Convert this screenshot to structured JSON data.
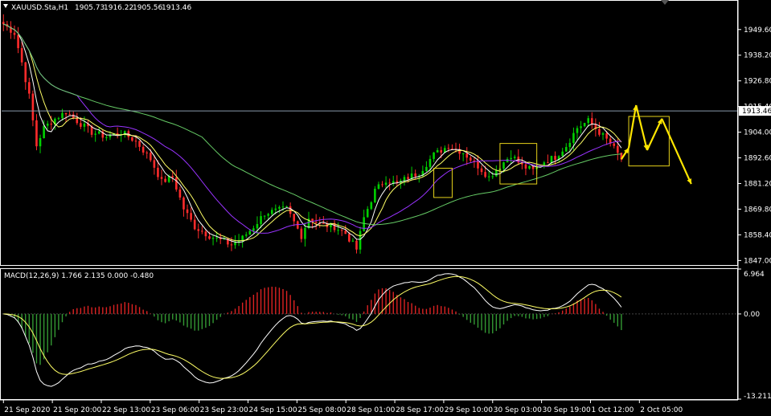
{
  "chart_data": [
    {
      "type": "candlestick",
      "title": "XAUUSD.Sta,H1",
      "ohlc": {
        "open": "1905.73",
        "high": "1916.22",
        "low": "1905.56",
        "close": "1913.46"
      },
      "price_label": "1913.46",
      "ylim": [
        1845.0,
        1962.0
      ],
      "yticks": [
        "1949.60",
        "1938.20",
        "1926.80",
        "1915.40",
        "1904.00",
        "1892.60",
        "1881.20",
        "1869.80",
        "1858.40",
        "1847.00"
      ],
      "xticks": [
        "21 Sep 2020",
        "21 Sep 20:00",
        "22 Sep 13:00",
        "23 Sep 06:00",
        "23 Sep 23:00",
        "24 Sep 15:00",
        "25 Sep 08:00",
        "28 Sep 01:00",
        "28 Sep 17:00",
        "29 Sep 10:00",
        "30 Sep 03:00",
        "30 Sep 19:00",
        "1 Oct 12:00",
        "2 Oct 05:00"
      ],
      "close_path": [
        {
          "t": 0,
          "v": 1952
        },
        {
          "t": 3,
          "v": 1948
        },
        {
          "t": 5,
          "v": 1935
        },
        {
          "t": 7,
          "v": 1920
        },
        {
          "t": 9,
          "v": 1898
        },
        {
          "t": 11,
          "v": 1906
        },
        {
          "t": 14,
          "v": 1910
        },
        {
          "t": 17,
          "v": 1913
        },
        {
          "t": 20,
          "v": 1909
        },
        {
          "t": 24,
          "v": 1904
        },
        {
          "t": 28,
          "v": 1902
        },
        {
          "t": 32,
          "v": 1904
        },
        {
          "t": 36,
          "v": 1900
        },
        {
          "t": 40,
          "v": 1892
        },
        {
          "t": 43,
          "v": 1882
        },
        {
          "t": 46,
          "v": 1884
        },
        {
          "t": 49,
          "v": 1870
        },
        {
          "t": 52,
          "v": 1862
        },
        {
          "t": 56,
          "v": 1858
        },
        {
          "t": 59,
          "v": 1856
        },
        {
          "t": 62,
          "v": 1854
        },
        {
          "t": 65,
          "v": 1857
        },
        {
          "t": 68,
          "v": 1862
        },
        {
          "t": 71,
          "v": 1868
        },
        {
          "t": 74,
          "v": 1869
        },
        {
          "t": 77,
          "v": 1870
        },
        {
          "t": 79,
          "v": 1864
        },
        {
          "t": 81,
          "v": 1858
        },
        {
          "t": 83,
          "v": 1866
        },
        {
          "t": 86,
          "v": 1863
        },
        {
          "t": 90,
          "v": 1862
        },
        {
          "t": 93,
          "v": 1859
        },
        {
          "t": 96,
          "v": 1852
        },
        {
          "t": 98,
          "v": 1866
        },
        {
          "t": 101,
          "v": 1878
        },
        {
          "t": 104,
          "v": 1883
        },
        {
          "t": 107,
          "v": 1881
        },
        {
          "t": 110,
          "v": 1884
        },
        {
          "t": 113,
          "v": 1886
        },
        {
          "t": 117,
          "v": 1894
        },
        {
          "t": 121,
          "v": 1898
        },
        {
          "t": 125,
          "v": 1895
        },
        {
          "t": 129,
          "v": 1889
        },
        {
          "t": 132,
          "v": 1884
        },
        {
          "t": 135,
          "v": 1889
        },
        {
          "t": 138,
          "v": 1894
        },
        {
          "t": 141,
          "v": 1889
        },
        {
          "t": 144,
          "v": 1887
        },
        {
          "t": 147,
          "v": 1891
        },
        {
          "t": 150,
          "v": 1893
        },
        {
          "t": 153,
          "v": 1898
        },
        {
          "t": 156,
          "v": 1906
        },
        {
          "t": 159,
          "v": 1909
        },
        {
          "t": 162,
          "v": 1904
        },
        {
          "t": 165,
          "v": 1899
        },
        {
          "t": 168,
          "v": 1892
        },
        {
          "t": 170,
          "v": 1897
        },
        {
          "t": 172,
          "v": 1916
        },
        {
          "t": 175,
          "v": 1896
        },
        {
          "t": 179,
          "v": 1910
        },
        {
          "t": 187,
          "v": 1881
        }
      ],
      "forecast_from": 168
    },
    {
      "type": "macd",
      "title": "MACD(12,26,9) 1.766 2.135 0.000 -0.480",
      "ylim": [
        -13.211,
        6.964
      ],
      "yticks": [
        "6.964",
        "0.00",
        "-13.211"
      ]
    }
  ]
}
